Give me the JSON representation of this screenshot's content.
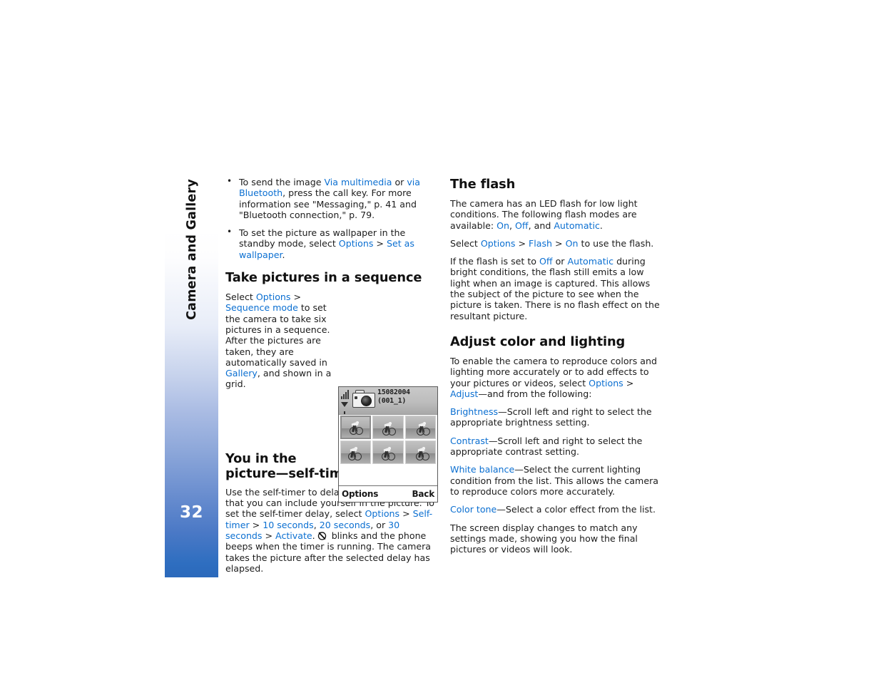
{
  "sidebar": {
    "chapter_title": "Camera and Gallery",
    "page_number": "32",
    "gradient_top": "#ffffff",
    "gradient_bottom": "#2b69bb"
  },
  "colors": {
    "link": "#0b6fd1",
    "body_text": "#1c1c1c",
    "heading": "#101010"
  },
  "left_column": {
    "bullets": [
      {
        "seg": [
          {
            "t": "To send the image ",
            "k": "plain"
          },
          {
            "t": "Via multimedia",
            "k": "link"
          },
          {
            "t": " or ",
            "k": "plain"
          },
          {
            "t": "via Bluetooth",
            "k": "link"
          },
          {
            "t": ", press the call key. For more information see \"Messaging,\" p. 41 and \"Bluetooth connection,\" p. 79.",
            "k": "plain"
          }
        ]
      },
      {
        "seg": [
          {
            "t": "To set the picture as wallpaper in the standby mode, select ",
            "k": "plain"
          },
          {
            "t": "Options",
            "k": "link"
          },
          {
            "t": " > ",
            "k": "plain"
          },
          {
            "t": "Set as wallpaper",
            "k": "link"
          },
          {
            "t": ".",
            "k": "plain"
          }
        ]
      }
    ],
    "heading_sequence": "Take pictures in a sequence",
    "sequence_paragraph": [
      {
        "t": "Select ",
        "k": "plain"
      },
      {
        "t": "Options",
        "k": "link"
      },
      {
        "t": " > ",
        "k": "plain"
      },
      {
        "t": "Sequence mode",
        "k": "link"
      },
      {
        "t": " to set the camera to take six pictures in a sequence. After the pictures are taken, they are automatically saved in ",
        "k": "plain"
      },
      {
        "t": "Gallery",
        "k": "link"
      },
      {
        "t": ", and shown in a grid.",
        "k": "plain"
      }
    ],
    "heading_selftimer_line1": "You in the",
    "heading_selftimer_line2": "picture—self-timer",
    "selftimer_paragraph_a": [
      {
        "t": "Use the self-timer to delay taking a picture so that you can include yourself in the picture. To set the self-timer delay, select ",
        "k": "plain"
      },
      {
        "t": "Options",
        "k": "link"
      },
      {
        "t": " > ",
        "k": "plain"
      },
      {
        "t": "Self-timer",
        "k": "link"
      },
      {
        "t": " > ",
        "k": "plain"
      },
      {
        "t": "10 seconds",
        "k": "link"
      },
      {
        "t": ", ",
        "k": "plain"
      },
      {
        "t": "20 seconds",
        "k": "link"
      },
      {
        "t": ", or ",
        "k": "plain"
      },
      {
        "t": "30 seconds",
        "k": "link"
      },
      {
        "t": " > ",
        "k": "plain"
      },
      {
        "t": "Activate",
        "k": "link"
      },
      {
        "t": ".",
        "k": "plain"
      }
    ],
    "selftimer_icon_name": "self-timer-icon",
    "selftimer_paragraph_b": [
      {
        "t": " blinks and the phone beeps when the timer is running. The camera takes the picture after the selected delay has elapsed.",
        "k": "plain"
      }
    ]
  },
  "phone_screenshot": {
    "date_line1": "15082004",
    "date_line2": "(001_1)",
    "softkey_left": "Options",
    "softkey_right": "Back",
    "thumbnail_count": 6,
    "selected_thumbnail_index": 1,
    "icons": [
      "signal-bars-icon",
      "antenna-icon",
      "camera-icon"
    ]
  },
  "right_column": {
    "heading_flash": "The flash",
    "flash_paragraph_1": [
      {
        "t": "The camera has an LED flash for low light conditions. The following flash modes are available: ",
        "k": "plain"
      },
      {
        "t": "On",
        "k": "link"
      },
      {
        "t": ", ",
        "k": "plain"
      },
      {
        "t": "Off",
        "k": "link"
      },
      {
        "t": ", and ",
        "k": "plain"
      },
      {
        "t": "Automatic",
        "k": "link"
      },
      {
        "t": ".",
        "k": "plain"
      }
    ],
    "flash_paragraph_2": [
      {
        "t": "Select ",
        "k": "plain"
      },
      {
        "t": "Options",
        "k": "link"
      },
      {
        "t": " > ",
        "k": "plain"
      },
      {
        "t": "Flash",
        "k": "link"
      },
      {
        "t": " > ",
        "k": "plain"
      },
      {
        "t": "On",
        "k": "link"
      },
      {
        "t": " to use the flash.",
        "k": "plain"
      }
    ],
    "flash_paragraph_3": [
      {
        "t": "If the flash is set to ",
        "k": "plain"
      },
      {
        "t": "Off",
        "k": "link"
      },
      {
        "t": " or ",
        "k": "plain"
      },
      {
        "t": "Automatic",
        "k": "link"
      },
      {
        "t": " during bright conditions, the flash still emits a low light when an image is captured. This allows the subject of the picture to see when the picture is taken. There is no flash effect on the resultant picture.",
        "k": "plain"
      }
    ],
    "heading_adjust": "Adjust color and lighting",
    "adjust_paragraph_1": [
      {
        "t": "To enable the camera to reproduce colors and lighting more accurately or to add effects to your pictures or videos, select ",
        "k": "plain"
      },
      {
        "t": "Options",
        "k": "link"
      },
      {
        "t": " > ",
        "k": "plain"
      },
      {
        "t": "Adjust",
        "k": "link"
      },
      {
        "t": "—and from the following:",
        "k": "plain"
      }
    ],
    "adjust_items": [
      [
        {
          "t": "Brightness",
          "k": "link"
        },
        {
          "t": "—Scroll left and right to select the appropriate brightness setting.",
          "k": "plain"
        }
      ],
      [
        {
          "t": "Contrast",
          "k": "link"
        },
        {
          "t": "—Scroll left and right to select the appropriate contrast setting.",
          "k": "plain"
        }
      ],
      [
        {
          "t": "White balance",
          "k": "link"
        },
        {
          "t": "—Select the current lighting condition from the list. This allows the camera to reproduce colors more accurately.",
          "k": "plain"
        }
      ],
      [
        {
          "t": "Color tone",
          "k": "link"
        },
        {
          "t": "—Select a color effect from the list.",
          "k": "plain"
        }
      ]
    ],
    "closing_paragraph": [
      {
        "t": "The screen display changes to match any settings made, showing you how the final pictures or videos will look.",
        "k": "plain"
      }
    ]
  }
}
